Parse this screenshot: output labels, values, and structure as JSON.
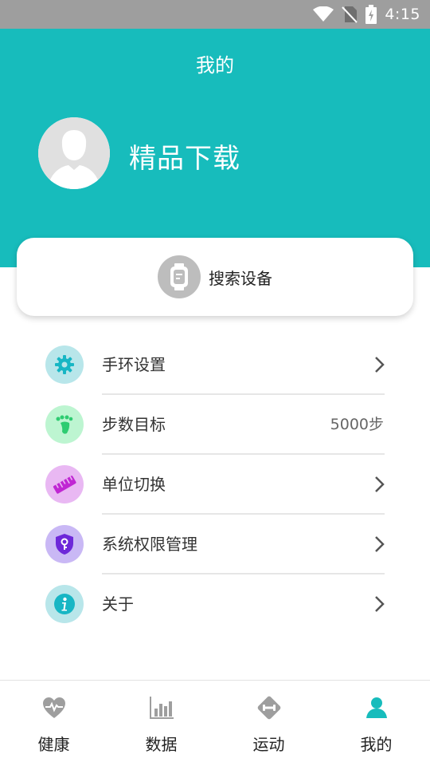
{
  "status_bar": {
    "time": "4:15",
    "icons": [
      "wifi-icon",
      "no-sim-icon",
      "battery-charging-icon"
    ]
  },
  "header": {
    "title": "我的",
    "username": "精品下载",
    "avatar_icon": "user-silhouette-icon"
  },
  "device_card": {
    "label": "搜索设备",
    "icon": "watch-icon"
  },
  "menu": {
    "items": [
      {
        "label": "手环设置",
        "icon": "gear-icon",
        "color": "#b8e6ea"
      },
      {
        "label": "步数目标",
        "icon": "footprint-icon",
        "color": "#bdf5d1",
        "value": "5000步"
      },
      {
        "label": "单位切换",
        "icon": "ruler-icon",
        "color": "#e9b8f3"
      },
      {
        "label": "系统权限管理",
        "icon": "shield-key-icon",
        "color": "#c9b8f5"
      },
      {
        "label": "关于",
        "icon": "info-icon",
        "color": "#b8e6ea"
      }
    ]
  },
  "tab_bar": {
    "tabs": [
      {
        "label": "健康",
        "icon": "heart-pulse-icon",
        "active": false
      },
      {
        "label": "数据",
        "icon": "bar-chart-icon",
        "active": false
      },
      {
        "label": "运动",
        "icon": "dumbbell-icon",
        "active": false
      },
      {
        "label": "我的",
        "icon": "person-icon",
        "active": true
      }
    ]
  },
  "colors": {
    "brand": "#17bcbc",
    "status_bar": "#9e9e9e",
    "tab_inactive": "#9e9e9e"
  }
}
